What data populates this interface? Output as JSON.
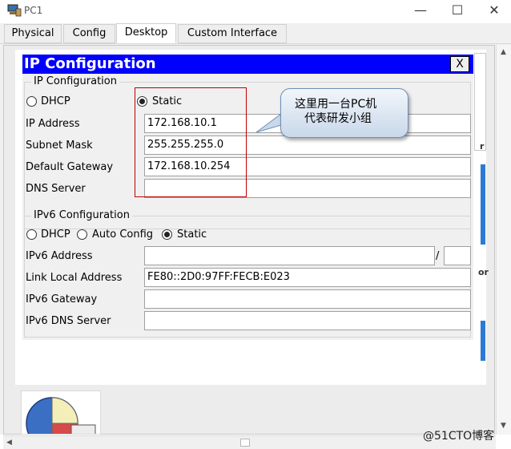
{
  "window": {
    "title": "PC1",
    "icons": {
      "app": "pc-icon",
      "minimize": "minimize-icon",
      "maximize": "maximize-icon",
      "close": "close-icon"
    },
    "minimize_glyph": "—",
    "maximize_glyph": "☐",
    "close_glyph": "✕"
  },
  "tabs": [
    {
      "label": "Physical"
    },
    {
      "label": "Config"
    },
    {
      "label": "Desktop"
    },
    {
      "label": "Custom Interface"
    }
  ],
  "active_tab": "Desktop",
  "background": {
    "fragment_right_1": "r",
    "fragment_right_2": "or"
  },
  "dialog": {
    "title": "IP Configuration",
    "close_label": "X",
    "ipv4": {
      "group_title": "IP Configuration",
      "mode": {
        "options": [
          "DHCP",
          "Static"
        ],
        "selected": "Static"
      },
      "ip_address": {
        "label": "IP Address",
        "value": "172.168.10.1"
      },
      "subnet_mask": {
        "label": "Subnet Mask",
        "value": "255.255.255.0"
      },
      "default_gateway": {
        "label": "Default Gateway",
        "value": "172.168.10.254"
      },
      "dns_server": {
        "label": "DNS Server",
        "value": ""
      }
    },
    "ipv6": {
      "group_title": "IPv6 Configuration",
      "mode": {
        "options": [
          "DHCP",
          "Auto Config",
          "Static"
        ],
        "selected": "Static"
      },
      "address": {
        "label": "IPv6 Address",
        "value": "",
        "prefix_separator": "/",
        "prefix_value": ""
      },
      "link_local": {
        "label": "Link Local Address",
        "value": "FE80::2D0:97FF:FECB:E023"
      },
      "gateway": {
        "label": "IPv6 Gateway",
        "value": ""
      },
      "dns_server": {
        "label": "IPv6 DNS Server",
        "value": ""
      }
    }
  },
  "annotation": {
    "callout_text": "这里用一台PC机\n代表研发小组",
    "highlight_color": "#c00000"
  },
  "watermark": "@51CTO博客",
  "colors": {
    "dialog_titlebar": "#0000ff",
    "panel": "#f0f0f0"
  }
}
